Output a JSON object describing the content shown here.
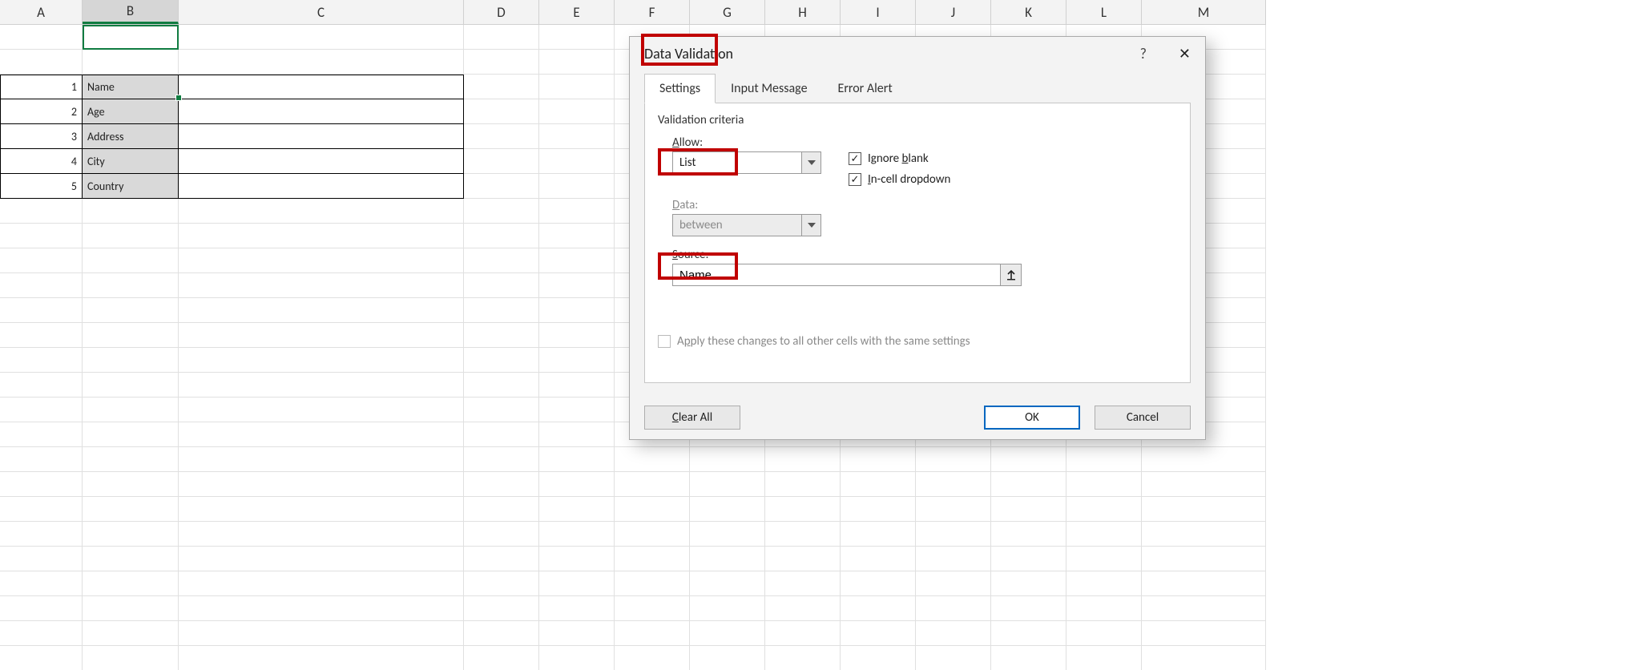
{
  "columns": [
    "A",
    "B",
    "C",
    "D",
    "E",
    "F",
    "G",
    "H",
    "I",
    "J",
    "K",
    "L",
    "M"
  ],
  "selected_column": "B",
  "table": {
    "rows": [
      {
        "n": "1",
        "label": "Name"
      },
      {
        "n": "2",
        "label": "Age"
      },
      {
        "n": "3",
        "label": "Address"
      },
      {
        "n": "4",
        "label": "City"
      },
      {
        "n": "5",
        "label": "Country"
      }
    ]
  },
  "dialog": {
    "title": "Data Validation",
    "help_glyph": "?",
    "close_glyph": "✕",
    "tabs": {
      "settings": "Settings",
      "input_message": "Input Message",
      "error_alert": "Error Alert"
    },
    "criteria_heading": "Validation criteria",
    "allow": {
      "label": "Allow:",
      "value": "List"
    },
    "ignore_blank": {
      "label": "Ignore blank",
      "checked": true,
      "u": "b"
    },
    "incell": {
      "label": "In-cell dropdown",
      "checked": true,
      "u": "I"
    },
    "data": {
      "label": "Data:",
      "value": "between"
    },
    "source": {
      "label": "Source:",
      "value": "Name"
    },
    "apply_all": {
      "label": "Apply these changes to all other cells with the same settings",
      "checked": false,
      "u": "P"
    },
    "buttons": {
      "clear": "Clear All",
      "ok": "OK",
      "cancel": "Cancel"
    }
  }
}
